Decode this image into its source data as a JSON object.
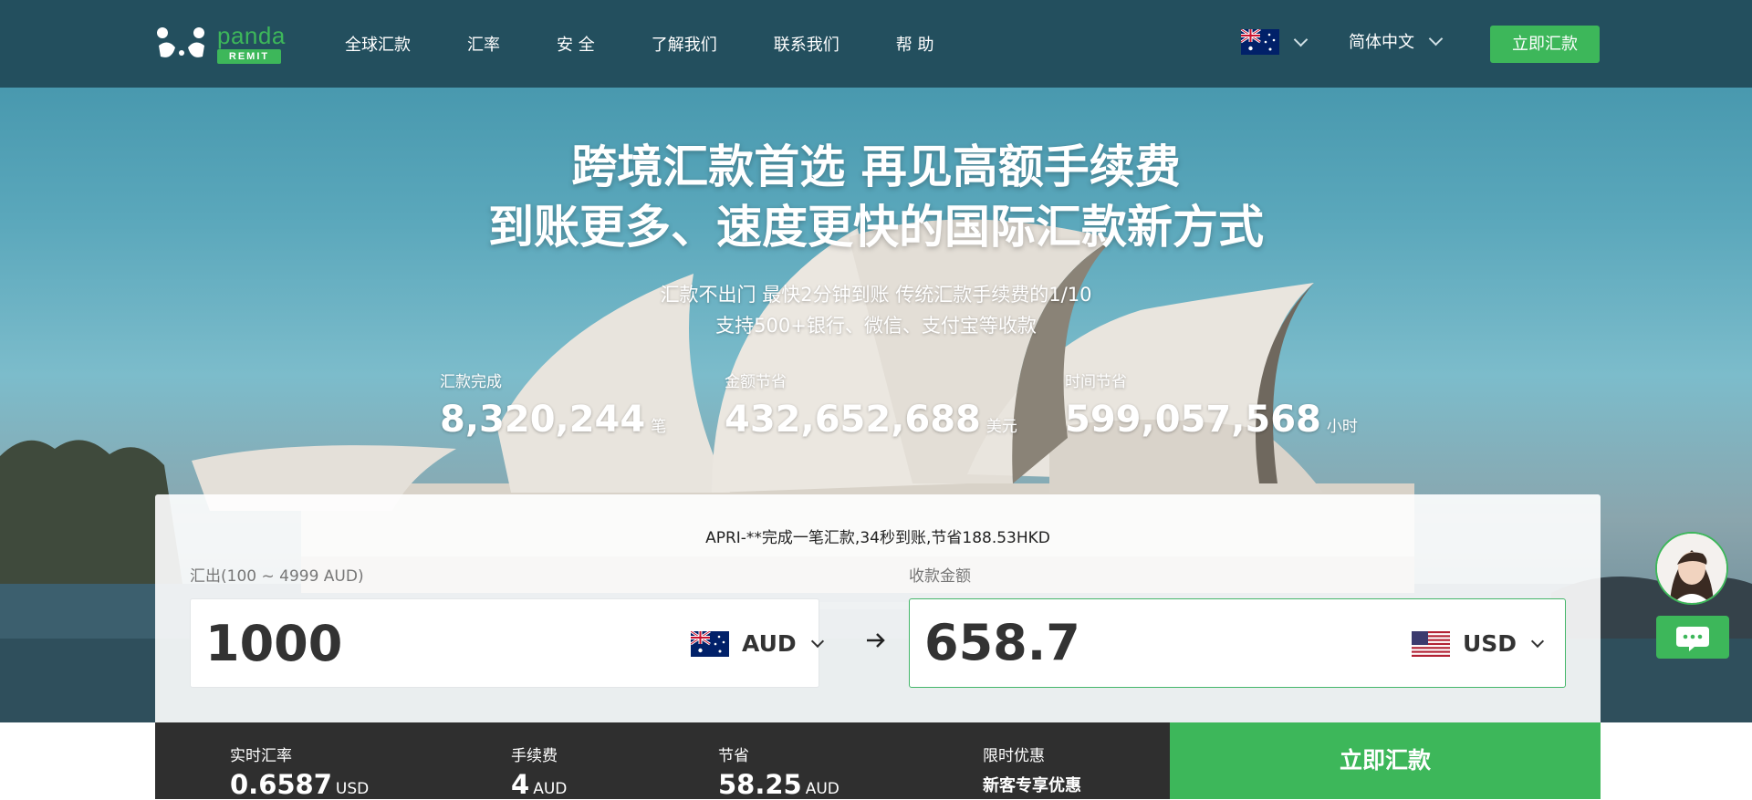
{
  "brand": {
    "name": "panda",
    "tag": "REMIT",
    "accent_color": "#3db75a",
    "header_color": "#234f5e"
  },
  "nav": {
    "items": [
      "全球汇款",
      "汇率",
      "安 全",
      "了解我们",
      "联系我们",
      "帮 助"
    ],
    "country_flag": "australia-flag-icon",
    "language": "简体中文",
    "cta": "立即汇款"
  },
  "hero": {
    "headline_line1": "跨境汇款首选 再见高额手续费",
    "headline_line2": "到账更多、速度更快的国际汇款新方式",
    "sub_line1": "汇款不出门 最快2分钟到账 传统汇款手续费的1/10",
    "sub_line2": "支持500+银行、微信、支付宝等收款"
  },
  "stats": [
    {
      "label": "汇款完成",
      "value": "8,320,244",
      "unit": "笔"
    },
    {
      "label": "金额节省",
      "value": "432,652,688",
      "unit": "美元"
    },
    {
      "label": "时间节省",
      "value": "599,057,568",
      "unit": "小时"
    }
  ],
  "calculator": {
    "notice": "APRI-**完成一笔汇款,34秒到账,节省188.53HKD",
    "send_label": "汇出(100 ~ 4999 AUD)",
    "send_amount": "1000",
    "send_currency": "AUD",
    "receive_label": "收款金额",
    "receive_amount": "658.7",
    "receive_currency": "USD"
  },
  "summary": {
    "rate_label": "实时汇率",
    "rate_value": "0.6587",
    "rate_unit": "USD",
    "fee_label": "手续费",
    "fee_value": "4",
    "fee_unit": "AUD",
    "save_label": "节省",
    "save_value": "58.25",
    "save_unit": "AUD",
    "promo_label": "限时优惠",
    "promo_value": "新客专享优惠",
    "cta": "立即汇款"
  },
  "chat": {
    "avatar_icon": "support-agent-avatar",
    "chat_icon": "chat-bubble-icon"
  }
}
